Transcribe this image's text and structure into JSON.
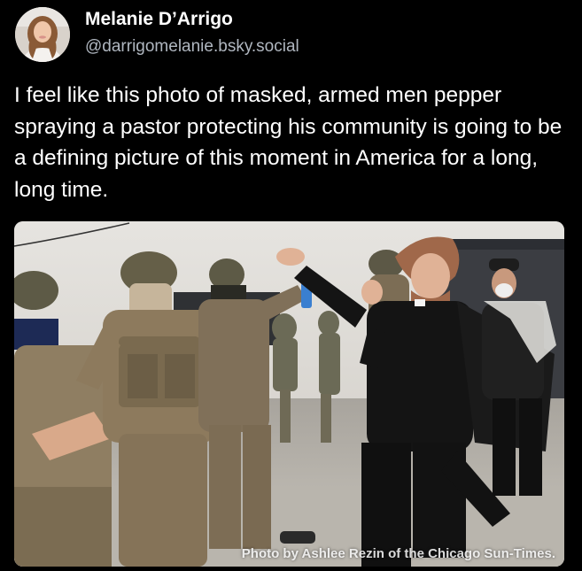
{
  "post": {
    "author": {
      "display_name": "Melanie D’Arrigo",
      "handle": "@darrigomelanie.bsky.social",
      "avatar_icon": "profile-photo"
    },
    "text": "I feel like this photo of masked, armed men pepper spraying a pastor protecting his community is going to be a defining picture of this moment in America for a long, long time.",
    "image": {
      "credit": "Photo by Ashlee Rezin of the Chicago Sun-Times."
    }
  },
  "colors": {
    "background": "#000000",
    "text_primary": "#ffffff",
    "text_secondary": "#b0b7c0"
  }
}
